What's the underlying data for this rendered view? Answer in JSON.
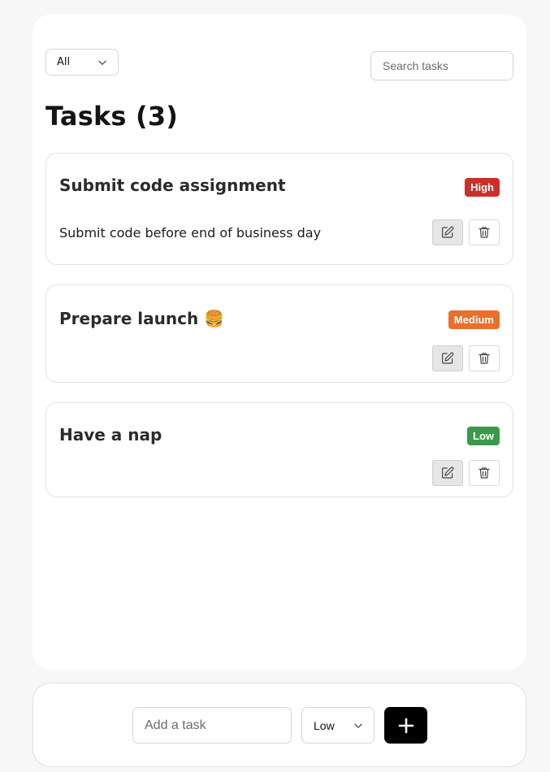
{
  "filter": {
    "selected": "All"
  },
  "search": {
    "placeholder": "Search tasks",
    "value": ""
  },
  "page": {
    "title": "Tasks (3)"
  },
  "tasks": [
    {
      "title": "Submit code assignment",
      "priority": "High",
      "priority_color": "#cc2f2b",
      "description": "Submit code before end of business day"
    },
    {
      "title": "Prepare launch 🍔",
      "priority": "Medium",
      "priority_color": "#e8702a",
      "description": ""
    },
    {
      "title": "Have a nap",
      "priority": "Low",
      "priority_color": "#3b9a4a",
      "description": ""
    }
  ],
  "icons": {
    "filter_chevron": "chevron-down-icon",
    "edit": "edit-icon",
    "delete": "trash-icon",
    "priority_chevron": "chevron-down-icon",
    "add": "plus-icon"
  },
  "add_task": {
    "placeholder": "Add a task",
    "value": "",
    "priority_selected": "Low"
  }
}
